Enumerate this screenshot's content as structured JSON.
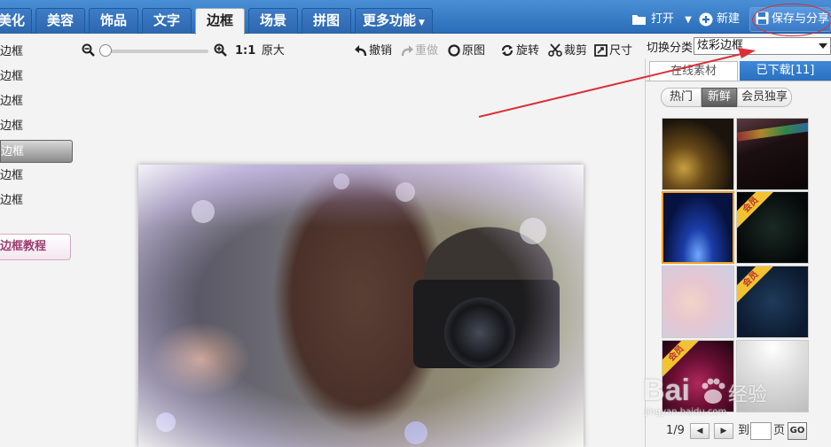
{
  "nav": {
    "tabs": [
      {
        "label": "美化"
      },
      {
        "label": "美容"
      },
      {
        "label": "饰品"
      },
      {
        "label": "文字"
      },
      {
        "label": "边框",
        "active": true
      },
      {
        "label": "场景"
      },
      {
        "label": "拼图"
      },
      {
        "label": "更多功能"
      }
    ],
    "open_label": "打开",
    "new_label": "新建",
    "save_label": "保存与分享"
  },
  "sidebar": {
    "items": [
      "边框",
      "边框",
      "边框",
      "边框",
      "边框",
      "边框",
      "边框"
    ],
    "active_index": 4,
    "tutorial_label": "边框教程"
  },
  "toolbar": {
    "zoom_ratio": "1:1",
    "original_size": "原大",
    "undo": "撤销",
    "redo": "重做",
    "original": "原图",
    "rotate": "旋转",
    "crop": "裁剪",
    "resize": "尺寸"
  },
  "right_panel": {
    "switch_label": "切换分类",
    "category_value": "炫彩边框",
    "tabs": {
      "online": "在线素材",
      "downloaded": "已下载[11]"
    },
    "segments": [
      "热门",
      "新鲜",
      "会员独享"
    ],
    "selected_segment": 1,
    "vip_badge": "会员",
    "pager": {
      "page": "1/9",
      "to": "到",
      "page_unit": "页",
      "go": "GO"
    }
  },
  "watermark": {
    "text": "Bai",
    "cn": "经验",
    "url": "jingyan.baidu.com"
  },
  "colors": {
    "nav_blue": "#2b6db8",
    "annotation_red": "#d8303a",
    "selected_border": "#f0a020"
  }
}
